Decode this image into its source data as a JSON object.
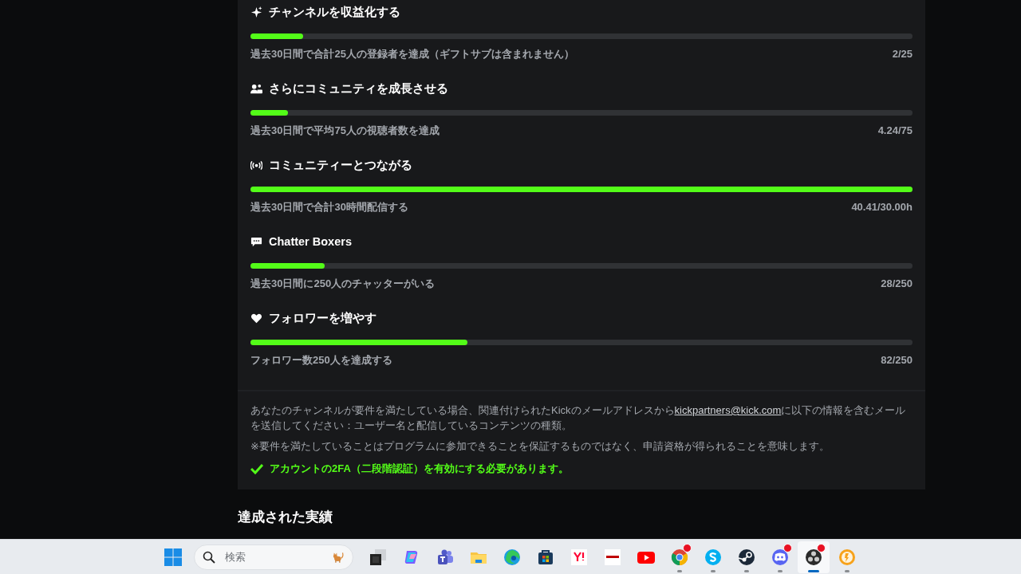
{
  "goals": [
    {
      "kind": "sparkle",
      "title": "チャンネルを収益化する",
      "level": 0.08,
      "description": "過去30日間で合計25人の登録者を達成（ギフトサブは含まれません）",
      "progress": "2/25"
    },
    {
      "kind": "people",
      "title": "さらにコミュニティを成長させる",
      "level": 0.057,
      "description": "過去30日間で平均75人の視聴者数を達成",
      "progress": "4.24/75"
    },
    {
      "kind": "broadcast",
      "title": "コミュニティーとつながる",
      "level": 1,
      "description": "過去30日間で合計30時間配信する",
      "progress": "40.41/30.00h"
    },
    {
      "kind": "chat",
      "title": "Chatter Boxers",
      "level": 0.112,
      "description": "過去30日間に250人のチャッターがいる",
      "progress": "28/250"
    },
    {
      "kind": "heart",
      "title": "フォロワーを増やす",
      "level": 0.328,
      "description": "フォロワー数250人を達成する",
      "progress": "82/250"
    }
  ],
  "info": {
    "text_before": "あなたのチャンネルが要件を満たしている場合、関連付けられたKickのメールアドレスから",
    "link": "kickpartners@kick.com",
    "text_after": "に以下の情報を含むメールを送信してください：ユーザー名と配信しているコンテンツの種類。",
    "note": "※要件を満たしていることはプログラムに参加できることを保証するものではなく、申請資格が得られることを意味します。",
    "requirement": "アカウントの2FA（二段階認証）を有効にする必要があります。",
    "requirement_met": true
  },
  "achievements_heading": "達成された実績",
  "taskbar": {
    "search": {
      "placeholder": "検索"
    },
    "apps": [
      {
        "kind": "taskview",
        "running": false,
        "active": false,
        "badge": false
      },
      {
        "kind": "copilot",
        "running": false,
        "active": false,
        "badge": false
      },
      {
        "kind": "teams",
        "running": false,
        "active": false,
        "badge": false
      },
      {
        "kind": "folder",
        "running": false,
        "active": false,
        "badge": false
      },
      {
        "kind": "edge",
        "running": false,
        "active": false,
        "badge": false
      },
      {
        "kind": "store",
        "running": false,
        "active": false,
        "badge": false
      },
      {
        "kind": "yahoo",
        "running": false,
        "active": false,
        "badge": false
      },
      {
        "kind": "rakuten",
        "running": false,
        "active": false,
        "badge": false
      },
      {
        "kind": "youtube",
        "running": false,
        "active": false,
        "badge": false
      },
      {
        "kind": "chrome",
        "running": true,
        "active": false,
        "badge": true
      },
      {
        "kind": "skype",
        "running": true,
        "active": false,
        "badge": false
      },
      {
        "kind": "steam",
        "running": true,
        "active": false,
        "badge": false
      },
      {
        "kind": "discord",
        "running": true,
        "active": false,
        "badge": true
      },
      {
        "kind": "obs",
        "running": true,
        "active": true,
        "badge": true
      },
      {
        "kind": "coin",
        "running": true,
        "active": false,
        "badge": false
      }
    ]
  }
}
